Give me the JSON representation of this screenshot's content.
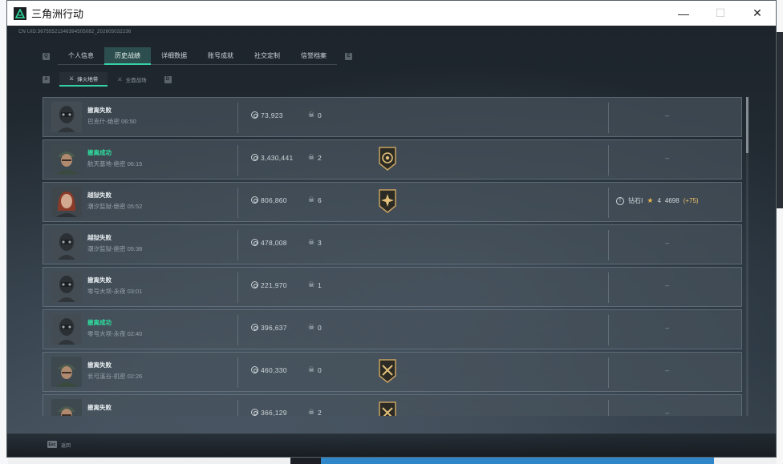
{
  "window": {
    "title": "三角洲行动",
    "uid": "CN UID:36755521346394505082_202605032236",
    "minimize": "—",
    "maximize": "☐",
    "close": "✕"
  },
  "tabs": [
    {
      "label": "个人信息",
      "active": false
    },
    {
      "label": "历史战绩",
      "active": true
    },
    {
      "label": "详细数据",
      "active": false
    },
    {
      "label": "账号成就",
      "active": false
    },
    {
      "label": "社交定制",
      "active": false
    },
    {
      "label": "信誉档案",
      "active": false
    }
  ],
  "nav_keys": {
    "prev": "Q",
    "next": "E",
    "sub_prev": "A",
    "sub_next": "D"
  },
  "subtabs": [
    {
      "label": "烽火地带",
      "icon": "⚔",
      "active": true
    },
    {
      "label": "全面战场",
      "icon": "⚔",
      "active": false
    }
  ],
  "rows": [
    {
      "status": "撤离失败",
      "ok": false,
      "map": "巴克什-绝密 06:50",
      "value": "73,923",
      "kills": "0",
      "badge": null,
      "rank": "--",
      "avatar": "mask"
    },
    {
      "status": "撤离成功",
      "ok": true,
      "map": "航天基地-绝密 06:15",
      "value": "3,430,441",
      "kills": "2",
      "badge": "ring",
      "rank": "--",
      "avatar": "cap"
    },
    {
      "status": "越狱失败",
      "ok": false,
      "map": "潮汐监狱-绝密 05:52",
      "value": "806,860",
      "kills": "6",
      "badge": "star",
      "rank": null,
      "avatar": "redhair"
    },
    {
      "status": "越狱失败",
      "ok": false,
      "map": "潮汐监狱-绝密 05:38",
      "value": "478,008",
      "kills": "3",
      "badge": null,
      "rank": "--",
      "avatar": "mask"
    },
    {
      "status": "撤离失败",
      "ok": false,
      "map": "零号大坝-永夜 03:01",
      "value": "221,970",
      "kills": "1",
      "badge": null,
      "rank": "--",
      "avatar": "mask"
    },
    {
      "status": "撤离成功",
      "ok": true,
      "map": "零号大坝-永夜 02:40",
      "value": "396,637",
      "kills": "0",
      "badge": null,
      "rank": "--",
      "avatar": "mask"
    },
    {
      "status": "撤离失败",
      "ok": false,
      "map": "长弓溪谷-机密 02:26",
      "value": "460,330",
      "kills": "0",
      "badge": "cross",
      "rank": "--",
      "avatar": "cap"
    },
    {
      "status": "撤离失败",
      "ok": false,
      "map": "",
      "value": "366,129",
      "kills": "2",
      "badge": "cross",
      "rank": "--",
      "avatar": "cap"
    }
  ],
  "rank_row_2": {
    "icon": "!",
    "tier": "钻石Ⅰ",
    "stars": "4",
    "score": "4698",
    "delta": "(+75)"
  },
  "footer": {
    "esc_key": "Esc",
    "esc_label": "返回"
  },
  "colors": {
    "accent": "#34d0a6",
    "success": "#2fe0a0",
    "gold": "#e8b44c"
  }
}
